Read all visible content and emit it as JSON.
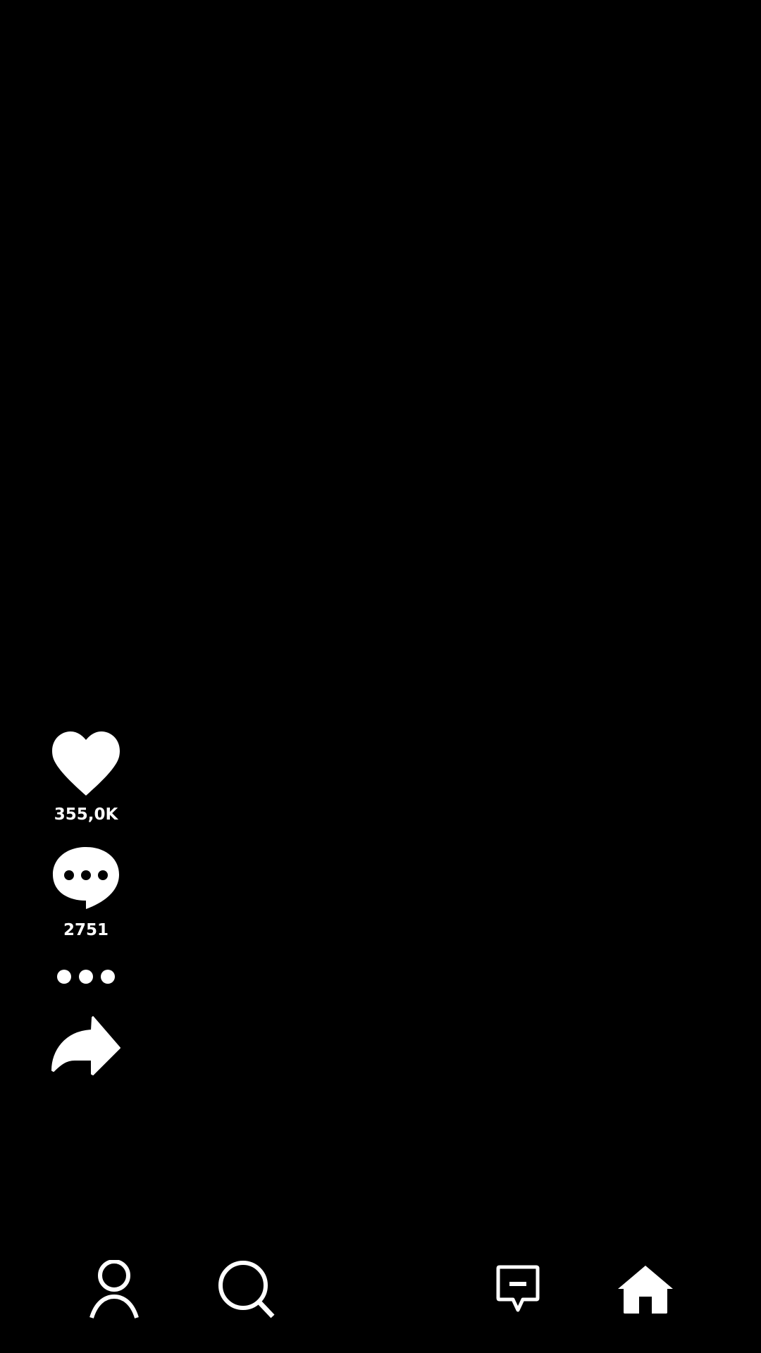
{
  "colors": {
    "background": "#000000",
    "foreground": "#ffffff"
  },
  "actions": {
    "like": {
      "icon": "heart-icon",
      "count": "355,0K"
    },
    "comment": {
      "icon": "comment-bubble-icon",
      "count": "2751"
    },
    "more": {
      "icon": "more-dots-icon"
    },
    "share": {
      "icon": "share-arrow-icon"
    }
  },
  "bottom_nav": [
    {
      "id": "profile",
      "icon": "person-icon"
    },
    {
      "id": "search",
      "icon": "search-icon"
    },
    {
      "id": "inbox",
      "icon": "message-icon"
    },
    {
      "id": "home",
      "icon": "home-icon",
      "active": true
    }
  ]
}
